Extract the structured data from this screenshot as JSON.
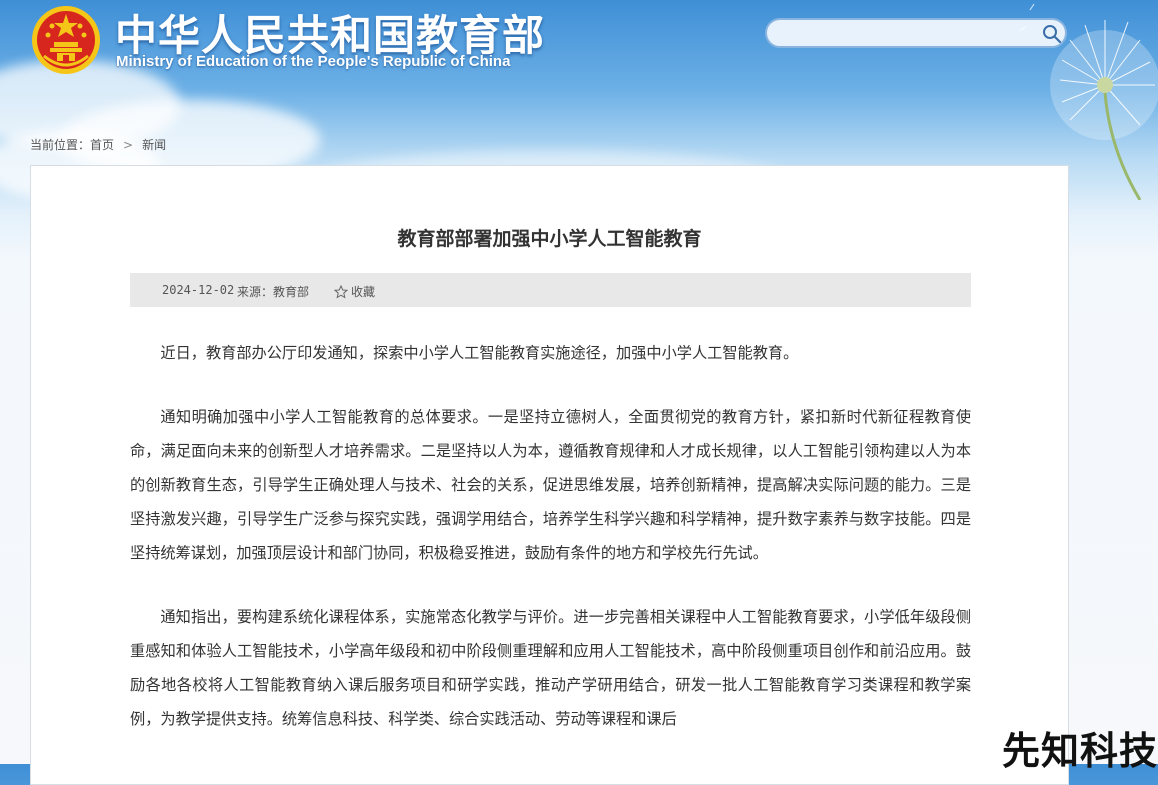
{
  "header": {
    "title_cn": "中华人民共和国教育部",
    "title_en": "Ministry of Education of the People's Republic of China",
    "search": {
      "placeholder": ""
    }
  },
  "breadcrumb": {
    "label": "当前位置：",
    "items": [
      "首页",
      "新闻"
    ],
    "separator": ">"
  },
  "article": {
    "title": "教育部部署加强中小学人工智能教育",
    "date": "2024-12-02",
    "source": "来源：教育部",
    "favorite": "收藏",
    "paragraphs": [
      "近日，教育部办公厅印发通知，探索中小学人工智能教育实施途径，加强中小学人工智能教育。",
      "通知明确加强中小学人工智能教育的总体要求。一是坚持立德树人，全面贯彻党的教育方针，紧扣新时代新征程教育使命，满足面向未来的创新型人才培养需求。二是坚持以人为本，遵循教育规律和人才成长规律，以人工智能引领构建以人为本的创新教育生态，引导学生正确处理人与技术、社会的关系，促进思维发展，培养创新精神，提高解决实际问题的能力。三是坚持激发兴趣，引导学生广泛参与探究实践，强调学用结合，培养学生科学兴趣和科学精神，提升数字素养与数字技能。四是坚持统筹谋划，加强顶层设计和部门协同，积极稳妥推进，鼓励有条件的地方和学校先行先试。",
      "通知指出，要构建系统化课程体系，实施常态化教学与评价。进一步完善相关课程中人工智能教育要求，小学低年级段侧重感知和体验人工智能技术，小学高年级段和初中阶段侧重理解和应用人工智能技术，高中阶段侧重项目创作和前沿应用。鼓励各地各校将人工智能教育纳入课后服务项目和研学实践，推动产学研用结合，研发一批人工智能教育学习类课程和教学案例，为教学提供支持。统筹信息科技、科学类、综合实践活动、劳动等课程和课后"
    ]
  },
  "watermark": "先知科技",
  "colors": {
    "header_blue": "#3f8fd6",
    "emblem_red": "#d7261e",
    "emblem_gold": "#f5c518",
    "meta_bg": "#e8e8e8"
  }
}
